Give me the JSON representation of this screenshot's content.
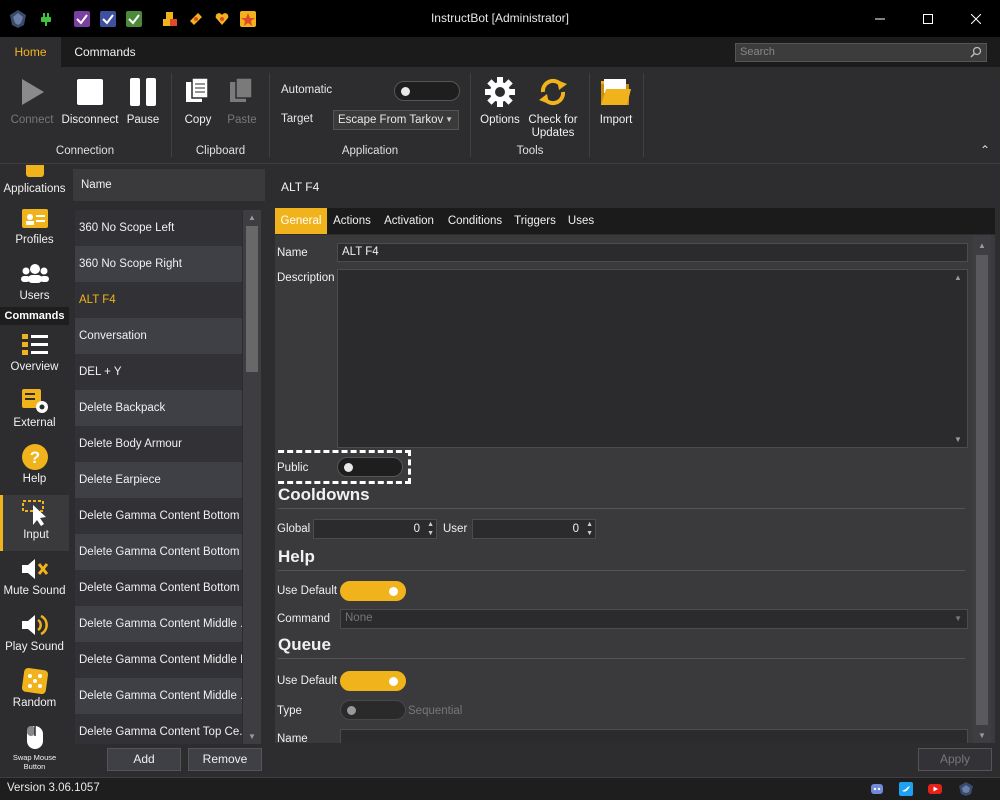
{
  "window": {
    "title": "InstructBot [Administrator]",
    "controls": [
      "minimize",
      "maximize",
      "close"
    ]
  },
  "menu_tabs": [
    "Home",
    "Commands"
  ],
  "search": {
    "placeholder": "Search"
  },
  "ribbon": {
    "connection": {
      "connect": "Connect",
      "disconnect": "Disconnect",
      "pause": "Pause",
      "group": "Connection"
    },
    "clipboard": {
      "copy": "Copy",
      "paste": "Paste",
      "group": "Clipboard"
    },
    "application": {
      "automatic_label": "Automatic",
      "target_label": "Target",
      "target_value": "Escape From Tarkov",
      "group": "Application"
    },
    "tools": {
      "options": "Options",
      "check_line1": "Check for",
      "check_line2": "Updates",
      "group": "Tools"
    },
    "import": "Import"
  },
  "sidebar": {
    "items": [
      "Applications",
      "Profiles",
      "Users",
      "Overview",
      "External",
      "Help",
      "Input",
      "Mute Sound",
      "Play Sound",
      "Random"
    ],
    "header": "Commands",
    "swap_line1": "Swap Mouse",
    "swap_line2": "Button"
  },
  "list": {
    "header": "Name",
    "items": [
      "360 No Scope Left",
      "360 No Scope Right",
      "ALT F4",
      "Conversation",
      "DEL + Y",
      "Delete Backpack",
      "Delete Body Armour",
      "Delete Earpiece",
      "Delete Gamma Content Bottom ...",
      "Delete Gamma Content Bottom ...",
      "Delete Gamma Content Bottom ...",
      "Delete Gamma Content Middle ...",
      "Delete Gamma Content Middle L...",
      "Delete Gamma Content Middle ...",
      "Delete Gamma Content Top Ce..."
    ],
    "add": "Add",
    "remove": "Remove"
  },
  "detail": {
    "title": "ALT F4",
    "tabs": [
      "General",
      "Actions",
      "Activation",
      "Conditions",
      "Triggers",
      "Uses"
    ],
    "name_label": "Name",
    "name_value": "ALT F4",
    "description_label": "Description",
    "public_label": "Public",
    "cooldowns": {
      "title": "Cooldowns",
      "global_label": "Global",
      "global_value": "0",
      "user_label": "User",
      "user_value": "0"
    },
    "help": {
      "title": "Help",
      "use_default_label": "Use Default",
      "command_label": "Command",
      "command_value": "None"
    },
    "queue": {
      "title": "Queue",
      "use_default_label": "Use Default",
      "type_label": "Type",
      "type_value": "Sequential",
      "name_label": "Name"
    },
    "apply": "Apply"
  },
  "status": {
    "version": "Version 3.06.1057",
    "social": [
      "discord-icon",
      "twitter-icon",
      "youtube-icon",
      "app-icon"
    ]
  },
  "colors": {
    "accent": "#f0b31b",
    "background": "#2d2d30",
    "titlebar": "#000000"
  }
}
